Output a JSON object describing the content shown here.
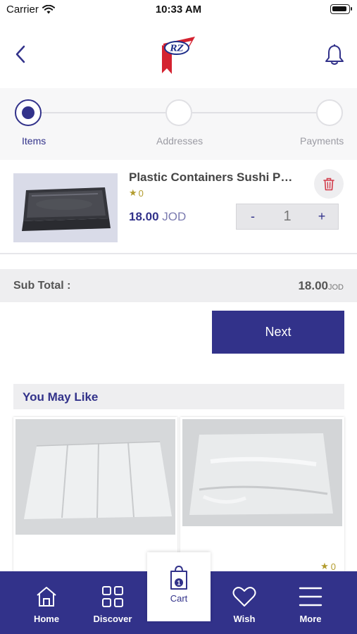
{
  "status_bar": {
    "carrier": "Carrier",
    "time": "10:33 AM"
  },
  "header": {
    "logo_text": "RZ"
  },
  "stepper": {
    "steps": [
      "Items",
      "Addresses",
      "Payments"
    ],
    "active_index": 0
  },
  "cart_item": {
    "name": "Plastic Containers Sushi Pet...",
    "rating": "0",
    "price": "18.00",
    "currency": "JOD",
    "quantity": "1",
    "minus_label": "-",
    "plus_label": "+"
  },
  "subtotal": {
    "label": "Sub Total :",
    "value": "18.00",
    "currency": "JOD"
  },
  "next_button": {
    "label": "Next"
  },
  "you_may_like": {
    "title": "You May Like",
    "products": [
      {
        "rating": ""
      },
      {
        "rating": "0"
      }
    ]
  },
  "tab_bar": {
    "tabs": [
      {
        "label": "Home",
        "icon": "home-icon"
      },
      {
        "label": "Discover",
        "icon": "grid-icon"
      },
      {
        "label": "Cart",
        "icon": "shopping-bag-icon",
        "badge": "1",
        "active": true
      },
      {
        "label": "Wish",
        "icon": "heart-icon"
      },
      {
        "label": "More",
        "icon": "menu-icon"
      }
    ]
  },
  "colors": {
    "primary": "#32328a",
    "star": "#b39c2e",
    "delete": "#d23b4a"
  }
}
